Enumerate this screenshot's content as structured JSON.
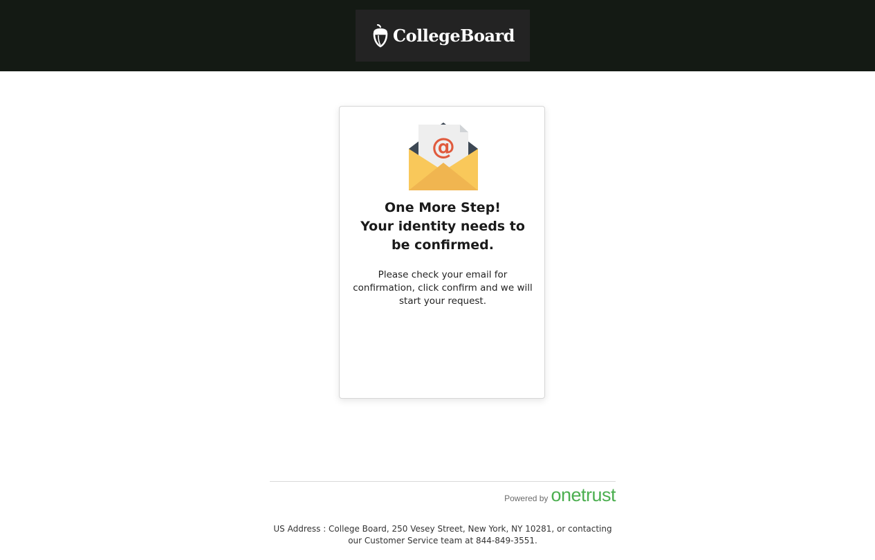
{
  "header": {
    "logo_text": "CollegeBoard",
    "logo_icon": "acorn-icon"
  },
  "card": {
    "icon": "envelope-email-icon",
    "icon_glyph": "@",
    "title_line1": "One More Step!",
    "title_line2": "Your identity needs to be confirmed.",
    "body": "Please check your email for confirmation, click confirm and we will start your request."
  },
  "footer": {
    "powered_label": "Powered by",
    "powered_brand": "onetrust",
    "address_line1": "US Address : College Board, 250 Vesey Street, New York, NY 10281, or contacting",
    "address_line2": "our Customer Service team at 844-849-3551."
  },
  "colors": {
    "header_bg": "#141a14",
    "logo_bg": "#232323",
    "brand_green": "#4caf50",
    "envelope_yellow": "#f9c85a",
    "at_sign_red": "#e05a3d"
  }
}
